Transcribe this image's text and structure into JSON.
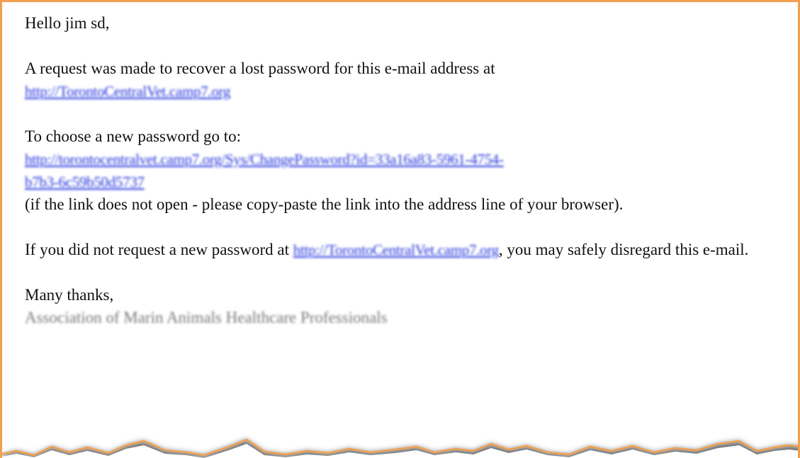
{
  "email": {
    "greeting": "Hello jim sd,",
    "para1_text": "A request was made to recover a lost password for this e-mail address at",
    "para1_link": "http://TorontoCentralVet.camp7.org",
    "para2_text": "To choose a new password go to:",
    "para2_link_line1": "http://torontocentralvet.camp7.org/Sys/ChangePassword?id=33a16a83-5961-4754-",
    "para2_link_line2": "b7b3-6c59b50d5737",
    "para2_note": "(if the link does not open - please copy-paste the link into the address line of your browser).",
    "para3_text_before": "If you did not request a new password at",
    "para3_link": "http://TorontoCentralVet.camp7.org",
    "para3_text_after": ", you may safely disregard this e-mail.",
    "closing": "Many thanks,",
    "signature": "Association of Marin Animals Healthcare Professionals"
  },
  "colors": {
    "frame_border": "#f0a050",
    "link": "#2233dd",
    "text": "#111111"
  }
}
